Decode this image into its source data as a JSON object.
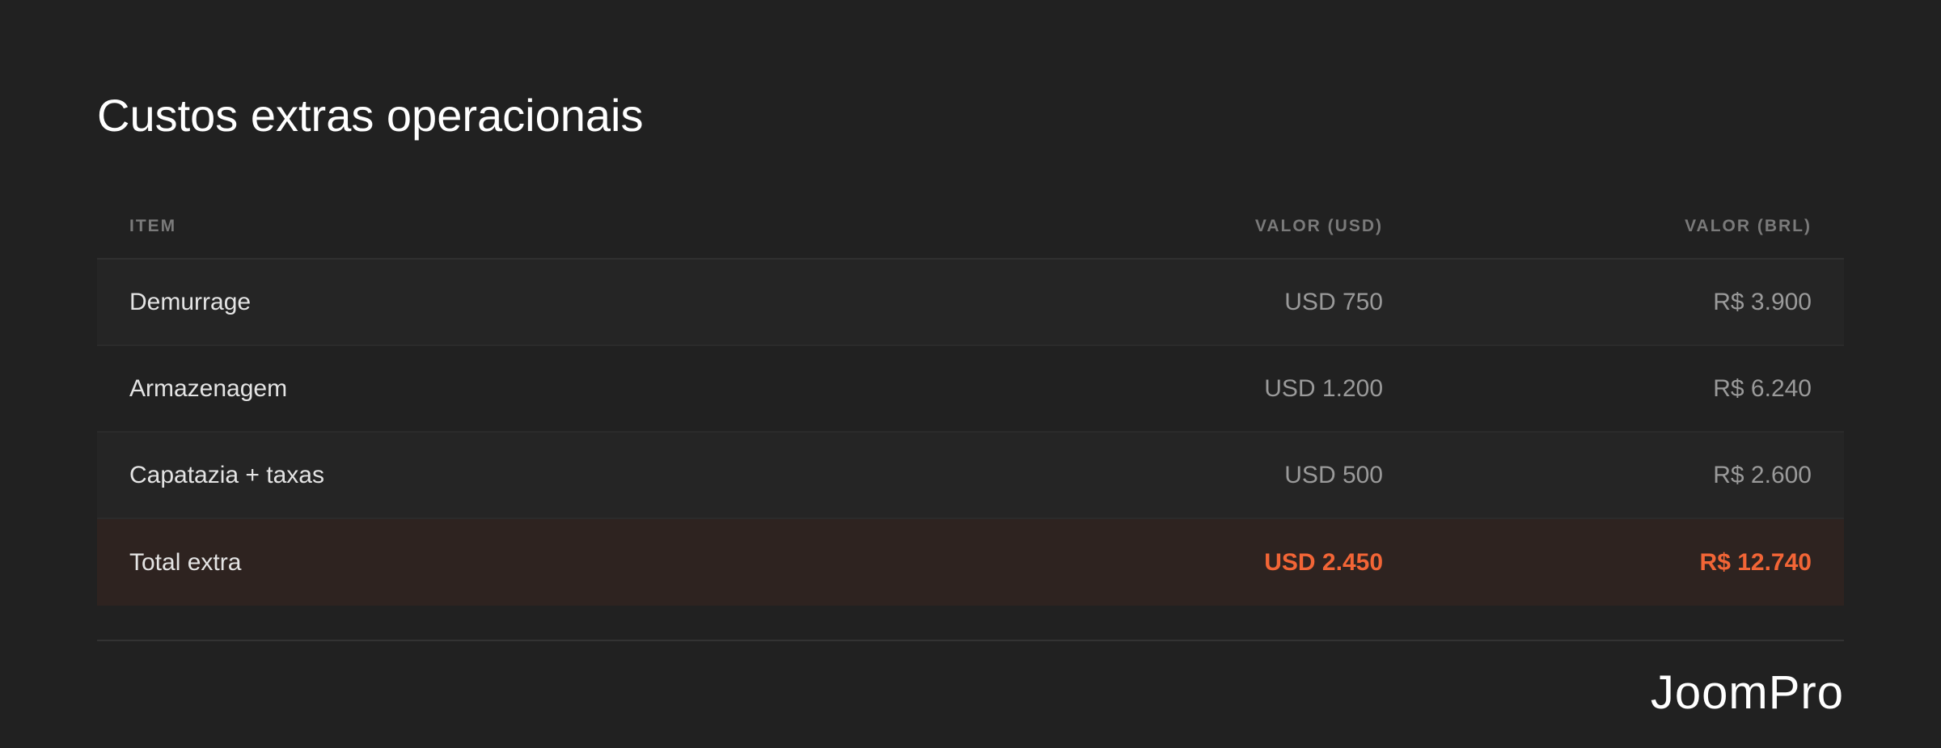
{
  "title": "Custos extras operacionais",
  "table": {
    "headers": {
      "item": "ITEM",
      "usd": "VALOR (USD)",
      "brl": "VALOR (BRL)"
    },
    "rows": [
      {
        "item": "Demurrage",
        "usd": "USD 750",
        "brl": "R$ 3.900"
      },
      {
        "item": "Armazenagem",
        "usd": "USD 1.200",
        "brl": "R$ 6.240"
      },
      {
        "item": "Capatazia + taxas",
        "usd": "USD 500",
        "brl": "R$ 2.600"
      }
    ],
    "total": {
      "item": "Total extra",
      "usd": "USD 2.450",
      "brl": "R$ 12.740"
    }
  },
  "logo": "JoomPro",
  "colors": {
    "background": "#212121",
    "accent": "#f26536",
    "total_row_bg": "#2e2320"
  }
}
